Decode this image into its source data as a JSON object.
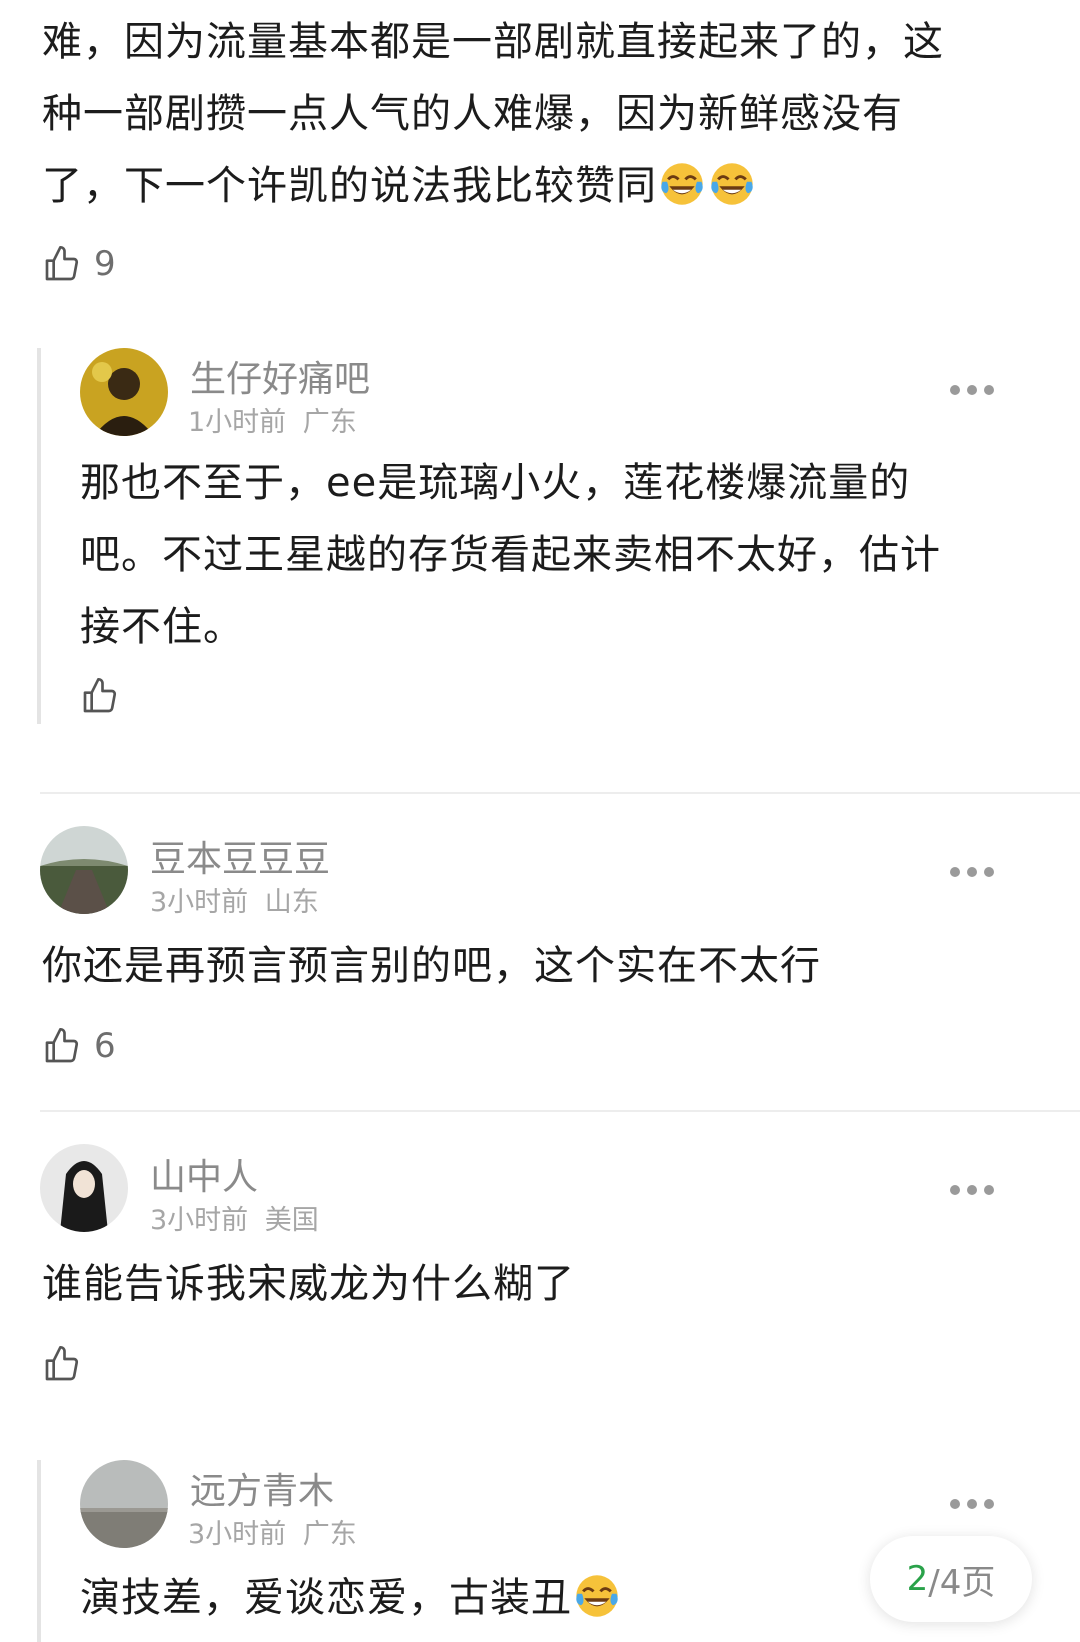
{
  "top_comment": {
    "line1": "难，因为流量基本都是一部剧就直接起来了的，这",
    "line2": "种一部剧攒一点人气的人难爆，因为新鲜感没有",
    "line3": "了，下一个许凯的说法我比较赞同",
    "emoji": [
      "laughing-tears",
      "laughing-tears"
    ],
    "likes": "9"
  },
  "reply1": {
    "username": "生仔好痛吧",
    "time": "1小时前",
    "location": "广东",
    "line1": "那也不至于，ee是琉璃小火，莲花楼爆流量的",
    "line2": "吧。不过王星越的存货看起来卖相不太好，估计",
    "line3": "接不住。",
    "likes": ""
  },
  "comment2": {
    "username": "豆本豆豆豆",
    "time": "3小时前",
    "location": "山东",
    "text": "你还是再预言预言别的吧，这个实在不太行",
    "likes": "6"
  },
  "comment3": {
    "username": "山中人",
    "time": "3小时前",
    "location": "美国",
    "text": "谁能告诉我宋威龙为什么糊了",
    "likes": ""
  },
  "reply2": {
    "username": "远方青木",
    "time": "3小时前",
    "location": "广东",
    "text": "演技差，爱谈恋爱，古装丑",
    "emoji": [
      "laughing-tears"
    ]
  },
  "pager": {
    "current": "2",
    "total": "/4页"
  },
  "colors": {
    "accent": "#2aa24a",
    "text": "#1c1c1c",
    "muted": "#8a8a8a"
  }
}
